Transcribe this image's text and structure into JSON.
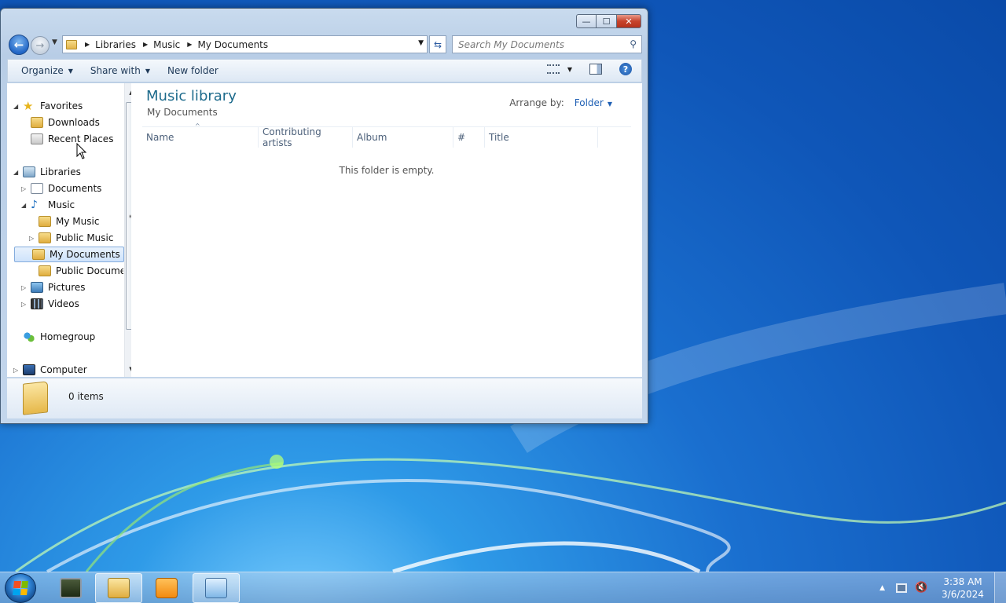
{
  "window": {
    "caption_buttons": {
      "minimize": "—",
      "maximize": "☐",
      "close": "✕"
    },
    "breadcrumb": [
      "Libraries",
      "Music",
      "My Documents"
    ],
    "search_placeholder": "Search My Documents"
  },
  "toolbar": {
    "organize": "Organize",
    "share_with": "Share with",
    "new_folder": "New folder"
  },
  "nav_pane": {
    "favorites": "Favorites",
    "downloads": "Downloads",
    "recent_places": "Recent Places",
    "libraries": "Libraries",
    "documents": "Documents",
    "music": "Music",
    "my_music": "My Music",
    "public_music": "Public Music",
    "my_documents": "My Documents",
    "public_documents": "Public Documents",
    "pictures": "Pictures",
    "videos": "Videos",
    "homegroup": "Homegroup",
    "computer": "Computer"
  },
  "content": {
    "title": "Music library",
    "subtitle": "My Documents",
    "arrange_label": "Arrange by:",
    "arrange_value": "Folder",
    "columns": [
      "Name",
      "Contributing artists",
      "Album",
      "#",
      "Title"
    ],
    "empty_message": "This folder is empty."
  },
  "details": {
    "items": "0 items"
  },
  "taskbar": {
    "time": "3:38 AM",
    "date": "3/6/2024"
  }
}
